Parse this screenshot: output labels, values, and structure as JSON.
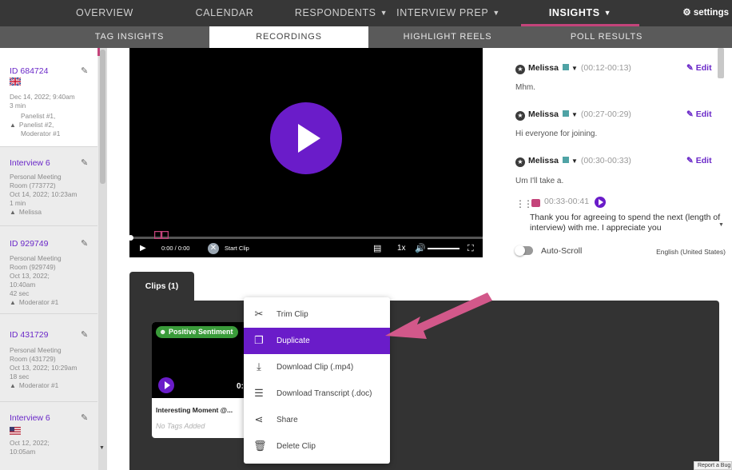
{
  "top_nav": {
    "items": [
      {
        "label": "OVERVIEW",
        "caret": false
      },
      {
        "label": "CALENDAR",
        "caret": false
      },
      {
        "label": "RESPONDENTS",
        "caret": true
      },
      {
        "label": "INTERVIEW PREP",
        "caret": true
      },
      {
        "label": "INSIGHTS",
        "caret": true,
        "active": true
      }
    ],
    "settings_label": "settings"
  },
  "sub_nav": {
    "items": [
      {
        "label": "TAG INSIGHTS"
      },
      {
        "label": "RECORDINGS",
        "active": true
      },
      {
        "label": "HIGHLIGHT REELS"
      },
      {
        "label": "POLL RESULTS"
      }
    ]
  },
  "sidebar": {
    "interviews": [
      {
        "title": "ID 684724",
        "flag": "uk",
        "lines": [
          "Dec 14, 2022; 9:40am",
          "3 min"
        ],
        "participants": [
          "Panelist #1,",
          "Panelist #2,",
          "Moderator #1"
        ],
        "selected": true
      },
      {
        "title": "Interview 6",
        "lines": [
          "Personal Meeting",
          "Room (773772)",
          "Oct 14, 2022; 10:23am",
          "1 min"
        ],
        "participants": [
          "Melissa"
        ]
      },
      {
        "title": "ID 929749",
        "lines": [
          "Personal Meeting",
          "Room (929749)",
          "Oct 13, 2022;",
          "10:40am",
          "42 sec"
        ],
        "participants": [
          "Moderator #1"
        ]
      },
      {
        "title": "ID 431729",
        "lines": [
          "Personal Meeting",
          "Room (431729)",
          "Oct 13, 2022; 10:29am",
          "18 sec"
        ],
        "participants": [
          "Moderator #1"
        ]
      },
      {
        "title": "Interview 6",
        "flag": "us",
        "lines": [
          "Oct 12, 2022;",
          "10:05am"
        ],
        "participants": []
      }
    ]
  },
  "player": {
    "time": "0:00 / 0:00",
    "start_clip_label": "Start Clip",
    "speed": "1x"
  },
  "transcript": {
    "entries": [
      {
        "speaker": "Melissa",
        "time": "(00:12-00:13)",
        "edit_label": "Edit",
        "text": "Mhm."
      },
      {
        "speaker": "Melissa",
        "time": "(00:27-00:29)",
        "edit_label": "Edit",
        "text": "Hi everyone for joining."
      },
      {
        "speaker": "Melissa",
        "time": "(00:30-00:33)",
        "edit_label": "Edit",
        "text": "Um I'll take a."
      }
    ],
    "clip": {
      "time": "00:33-00:41",
      "text": "Thank you for agreeing to spend the next (length of interview) with me. I appreciate you"
    },
    "auto_scroll_label": "Auto-Scroll",
    "language": "English (United States)"
  },
  "clips": {
    "tab_label": "Clips (1)",
    "card": {
      "sentiment": "Positive Sentiment",
      "duration": "0:",
      "title": "Interesting Moment @...",
      "tags": "No Tags Added"
    }
  },
  "context_menu": {
    "items": [
      {
        "label": "Trim Clip",
        "icon": "scissors-icon"
      },
      {
        "label": "Duplicate",
        "icon": "copy-icon",
        "active": true
      },
      {
        "label": "Download Clip (.mp4)",
        "icon": "download-icon"
      },
      {
        "label": "Download Transcript (.doc)",
        "icon": "lines-icon"
      },
      {
        "label": "Share",
        "icon": "share-icon"
      },
      {
        "label": "Delete Clip",
        "icon": "trash-icon"
      }
    ]
  },
  "report_bug_label": "Report a Bug",
  "colors": {
    "accent_purple": "#6a1cc9",
    "accent_pink": "#c4437a",
    "sentiment_green": "#3a9b3a"
  }
}
